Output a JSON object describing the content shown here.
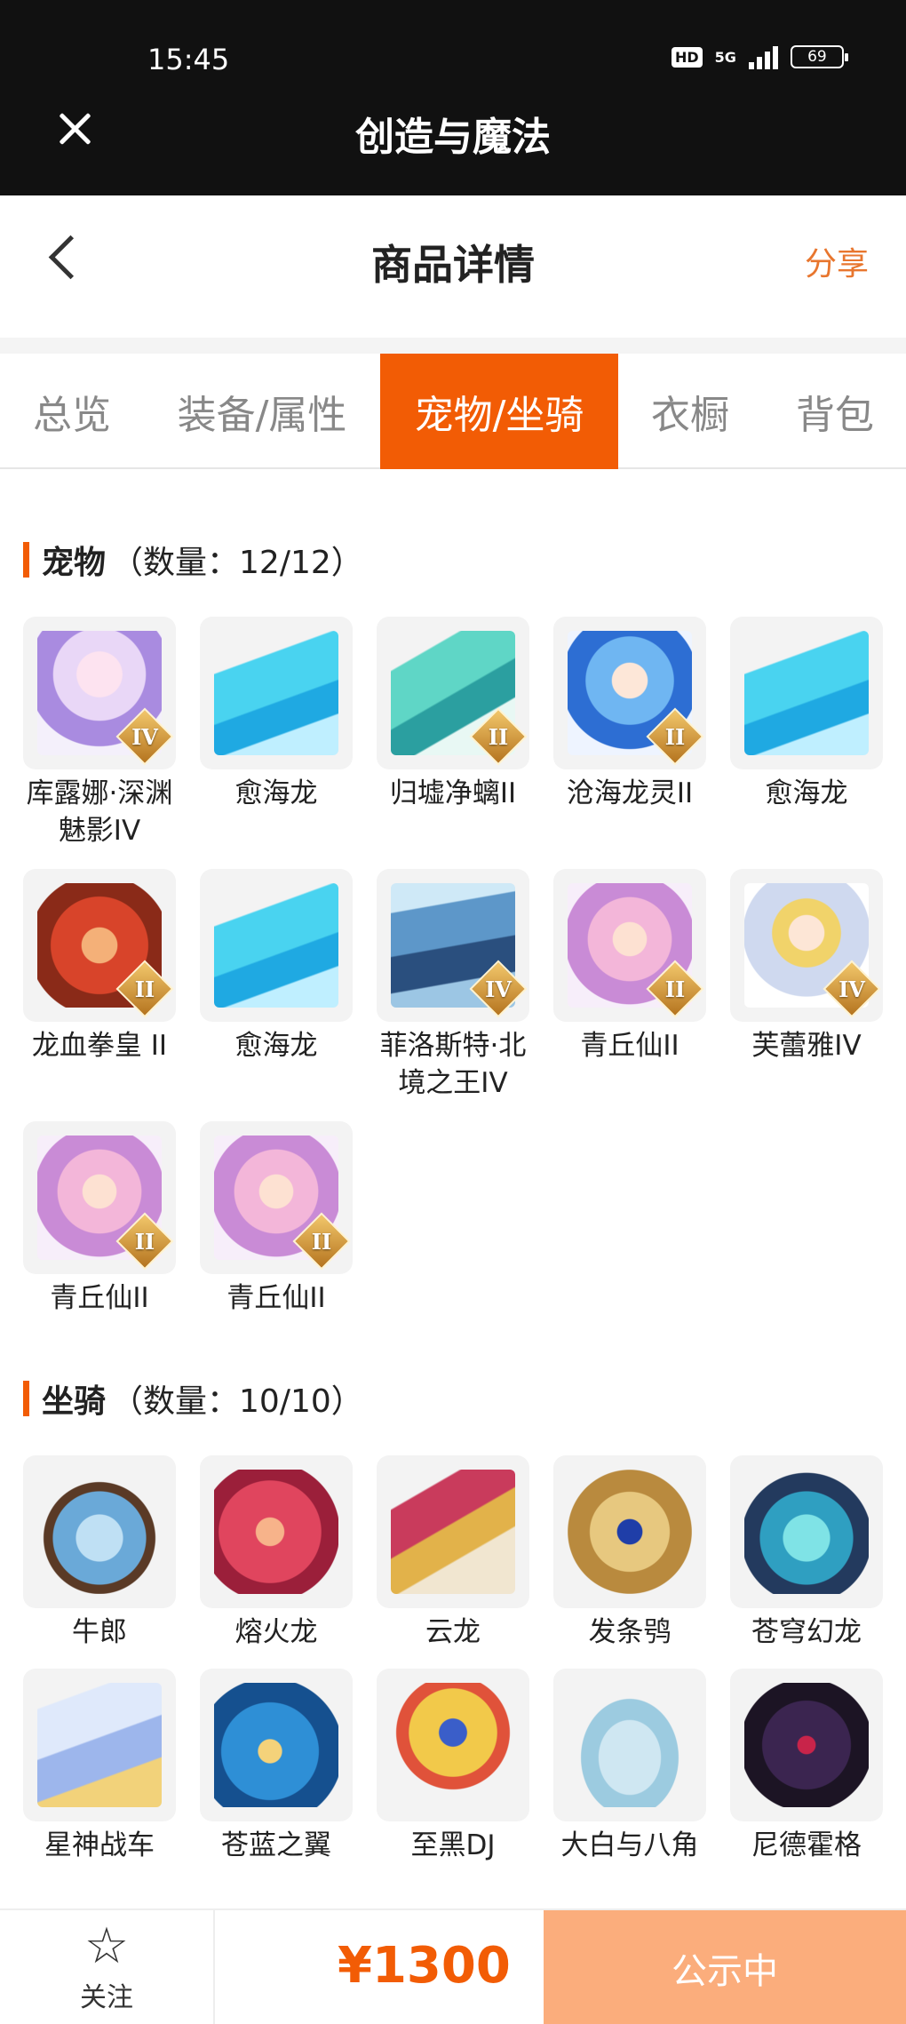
{
  "status_bar": {
    "time": "15:45",
    "hd": "HD",
    "network": "5G",
    "battery": "69"
  },
  "app_bar": {
    "title": "创造与魔法"
  },
  "header": {
    "title": "商品详情",
    "share": "分享"
  },
  "tabs": [
    {
      "label": "总览",
      "active": false
    },
    {
      "label": "装备/属性",
      "active": false
    },
    {
      "label": "宠物/坐骑",
      "active": true
    },
    {
      "label": "衣橱",
      "active": false
    },
    {
      "label": "背包",
      "active": false
    }
  ],
  "pets": {
    "title": "宠物",
    "count": "（数量：12/12）",
    "items": [
      {
        "name": "库露娜·深渊魅影IV",
        "rank": "IV",
        "icon": "pet-kuluna-art"
      },
      {
        "name": "愈海龙",
        "rank": "",
        "icon": "pet-yuhailong-art"
      },
      {
        "name": "归墟净螭II",
        "rank": "II",
        "icon": "pet-guixu-art"
      },
      {
        "name": "沧海龙灵II",
        "rank": "II",
        "icon": "pet-canghai-art"
      },
      {
        "name": "愈海龙",
        "rank": "",
        "icon": "pet-yuhailong-art"
      },
      {
        "name": "龙血拳皇 II",
        "rank": "II",
        "icon": "pet-longxue-art"
      },
      {
        "name": "愈海龙",
        "rank": "",
        "icon": "pet-yuhailong-art"
      },
      {
        "name": "菲洛斯特·北境之王IV",
        "rank": "IV",
        "icon": "pet-feiluo-art"
      },
      {
        "name": "青丘仙II",
        "rank": "II",
        "icon": "pet-qingqiu-art"
      },
      {
        "name": "芙蕾雅IV",
        "rank": "IV",
        "icon": "pet-fuleiya-art"
      },
      {
        "name": "青丘仙II",
        "rank": "II",
        "icon": "pet-qingqiu-art"
      },
      {
        "name": "青丘仙II",
        "rank": "II",
        "icon": "pet-qingqiu-art"
      }
    ]
  },
  "mounts": {
    "title": "坐骑",
    "count": "（数量：10/10）",
    "items": [
      {
        "name": "牛郎",
        "icon": "mount-niulang-art"
      },
      {
        "name": "熔火龙",
        "icon": "mount-ronghuo-art"
      },
      {
        "name": "云龙",
        "icon": "mount-yunlong-art"
      },
      {
        "name": "发条鸮",
        "icon": "mount-owl-art"
      },
      {
        "name": "苍穹幻龙",
        "icon": "mount-cangqiong-art"
      },
      {
        "name": "星神战车",
        "icon": "mount-xingshen-art"
      },
      {
        "name": "苍蓝之翼",
        "icon": "mount-canglan-art"
      },
      {
        "name": "至黑DJ",
        "icon": "mount-dj-art"
      },
      {
        "name": "大白与八角",
        "icon": "mount-whale-art"
      },
      {
        "name": "尼德霍格",
        "icon": "mount-nidhogg-art"
      }
    ]
  },
  "footer": {
    "follow": "关注",
    "price": "¥1300",
    "status": "公示中"
  },
  "colors": {
    "accent": "#f25c05",
    "share": "#e8762e",
    "status_button": "#fbad7c"
  }
}
